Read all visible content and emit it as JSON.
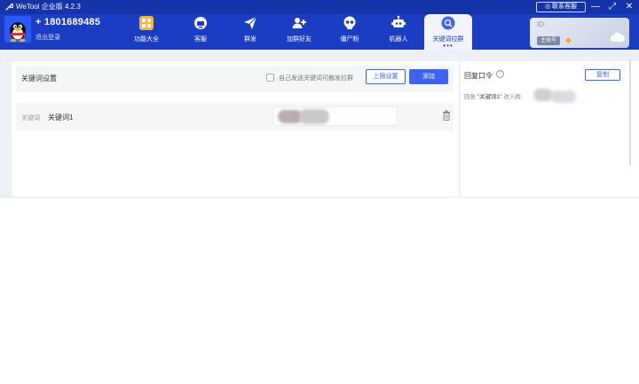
{
  "window": {
    "title": "WeTool 企业版 4.2.3",
    "contact_label": "联系客服",
    "controls": [
      "minimize",
      "maximize",
      "close"
    ]
  },
  "user": {
    "phone": "+ 1801689485",
    "logout_label": "退出登录"
  },
  "nav": {
    "items": [
      {
        "label": "功能大全",
        "icon": "grid-icon"
      },
      {
        "label": "客服",
        "icon": "headset-icon"
      },
      {
        "label": "群发",
        "icon": "send-icon"
      },
      {
        "label": "加群好友",
        "icon": "add-group-icon"
      },
      {
        "label": "僵尸粉",
        "icon": "skull-icon"
      },
      {
        "label": "机器人",
        "icon": "robot-icon"
      },
      {
        "label": "关键词拉群",
        "icon": "keyword-icon",
        "active": true
      }
    ]
  },
  "account_card": {
    "id_label": "ID:",
    "badge": "主账号"
  },
  "keyword_panel": {
    "title": "关键词设置",
    "checkbox_label": "自己发送关键词可触发拉群",
    "limit_button": "上限设置",
    "add_button": "添加",
    "rows": [
      {
        "label": "关键词",
        "value": "关键词1"
      }
    ]
  },
  "reply_panel": {
    "title": "回复口令",
    "copy_button": "复制",
    "text_prefix": "回复",
    "keyword_quote": "\"关键词1\"",
    "text_suffix": "进入群"
  },
  "colors": {
    "header_bg": "#1a3dc4",
    "titlebar_bg": "#1433a8",
    "accent": "#3d63f0",
    "content_bg": "#eef0f7"
  }
}
